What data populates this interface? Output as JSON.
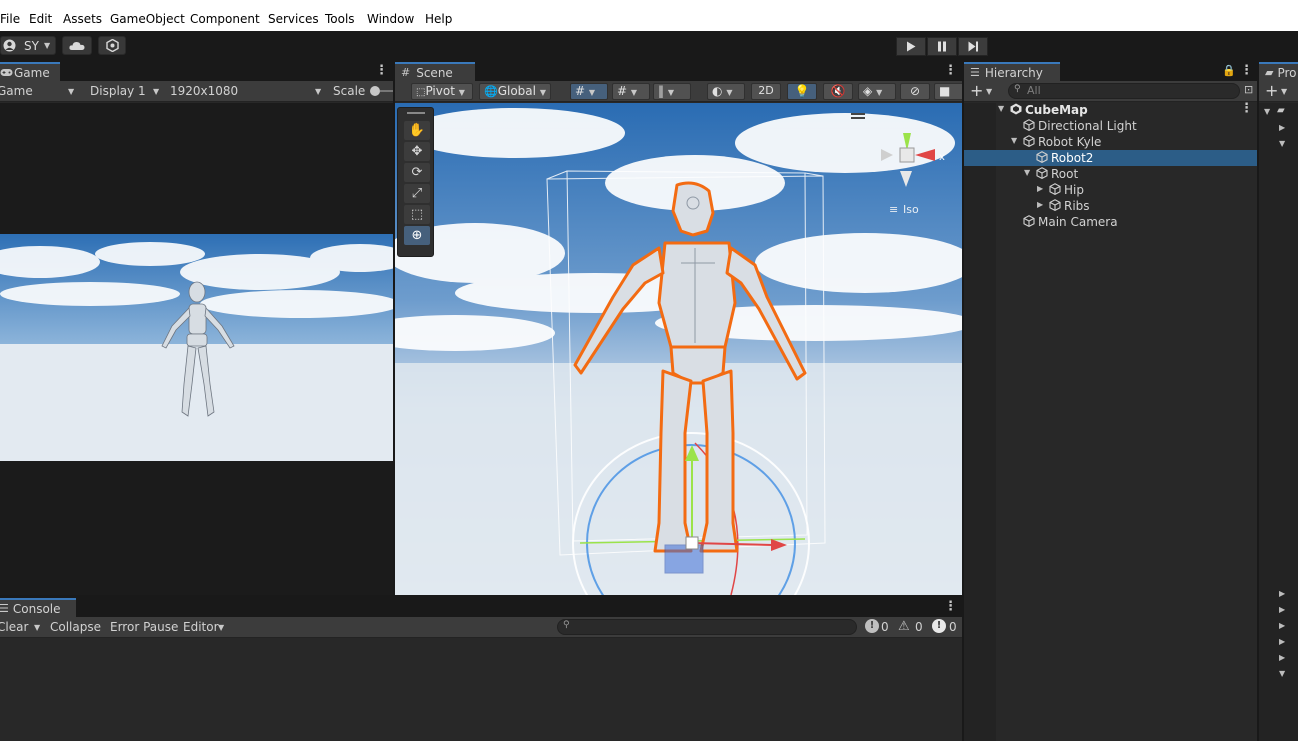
{
  "menu": [
    "File",
    "Edit",
    "Assets",
    "GameObject",
    "Component",
    "Services",
    "Tools",
    "Window",
    "Help"
  ],
  "toolbar": {
    "account": "SY"
  },
  "game": {
    "tab": "Game",
    "mode": "Game",
    "display": "Display 1",
    "resolution": "1920x1080",
    "scale": "Scale"
  },
  "scene": {
    "tab": "Scene",
    "pivot": "Pivot",
    "global": "Global",
    "mode_2d": "2D",
    "gizmo_axis": "x",
    "iso": "Iso"
  },
  "hierarchy": {
    "tab": "Hierarchy",
    "search_placeholder": "All",
    "items": [
      {
        "label": "CubeMap",
        "depth": 0,
        "expanded": true,
        "bold": true,
        "selected": false
      },
      {
        "label": "Directional Light",
        "depth": 1,
        "selected": false
      },
      {
        "label": "Robot Kyle",
        "depth": 1,
        "expanded": true,
        "selected": false
      },
      {
        "label": "Robot2",
        "depth": 2,
        "selected": true
      },
      {
        "label": "Root",
        "depth": 2,
        "expanded": true,
        "selected": false
      },
      {
        "label": "Hip",
        "depth": 3,
        "collapsed": true,
        "selected": false
      },
      {
        "label": "Ribs",
        "depth": 3,
        "collapsed": true,
        "selected": false
      },
      {
        "label": "Main Camera",
        "depth": 1,
        "selected": false
      }
    ]
  },
  "project": {
    "tab": "Pro"
  },
  "console": {
    "tab": "Console",
    "clear": "Clear",
    "collapse": "Collapse",
    "error_pause": "Error Pause",
    "editor": "Editor",
    "info_count": "0",
    "warn_count": "0",
    "error_count": "0"
  },
  "colors": {
    "accent": "#3a79bb",
    "selection": "#2c5d87",
    "outline": "#f36b12"
  }
}
